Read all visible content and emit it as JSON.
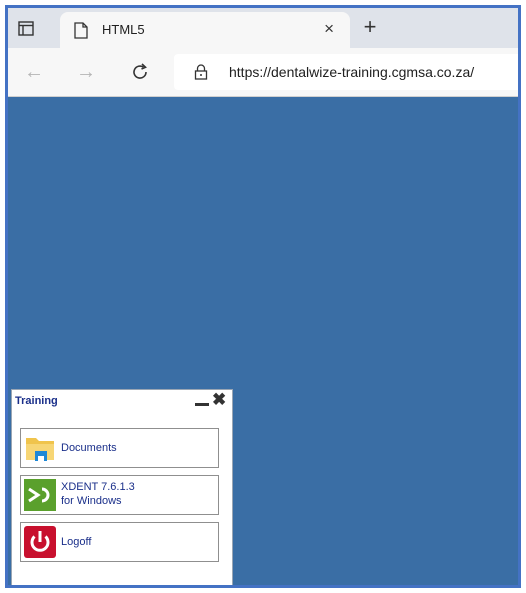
{
  "browser": {
    "tab": {
      "title": "HTML5",
      "close_glyph": "×"
    },
    "new_tab_glyph": "+",
    "nav": {
      "back_glyph": "←",
      "forward_glyph": "→",
      "refresh_glyph": "C"
    },
    "address": {
      "url": "https://dentalwize-training.cgmsa.co.za/"
    }
  },
  "desktop": {
    "background": "#3a6ea5"
  },
  "panel": {
    "title": "Training",
    "close_glyph": "✖",
    "apps": [
      {
        "label_line1": "Documents",
        "label_line2": "",
        "icon": "folder-icon"
      },
      {
        "label_line1": "XDENT 7.6.1.3",
        "label_line2": "for Windows",
        "icon": "xdent-icon"
      },
      {
        "label_line1": "Logoff",
        "label_line2": "",
        "icon": "power-icon"
      }
    ]
  }
}
